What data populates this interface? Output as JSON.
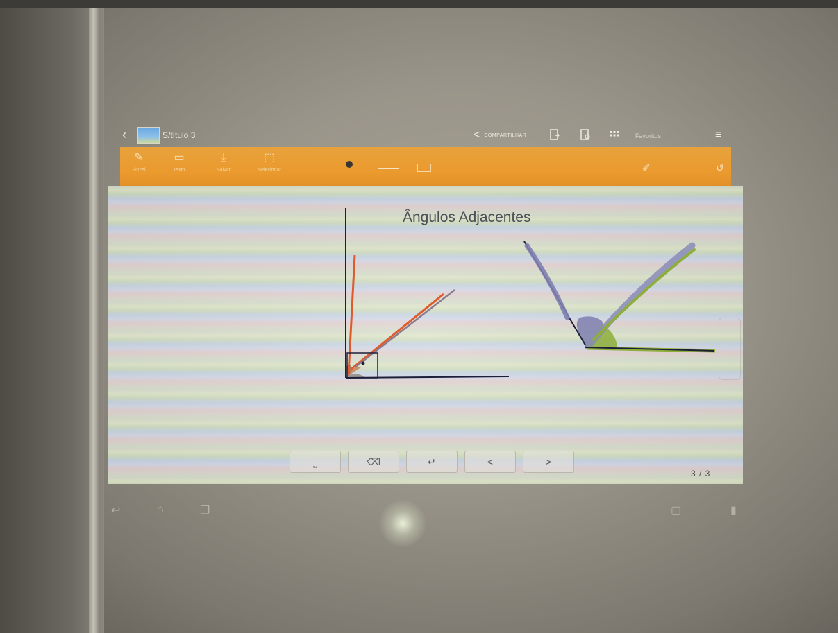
{
  "titlebar": {
    "doc_title": "S/título 3",
    "share_label": "COMPARTILHAR",
    "favorites_label": "Favoritos"
  },
  "toolbar": {
    "tools": [
      {
        "name": "Pincel"
      },
      {
        "name": "Texto"
      },
      {
        "name": "Salvar"
      },
      {
        "name": "Selecionar"
      }
    ]
  },
  "canvas": {
    "title": "Ângulos Adjacentes"
  },
  "keypad": {
    "space": "⎵",
    "backspace": "⌫",
    "enter": "↵",
    "prev": "<",
    "next": ">"
  },
  "page_counter": "3 / 3",
  "colors": {
    "toolbar": "#eb9a2e",
    "ink_black": "#1d1f3a",
    "ink_orange": "#e05a2c",
    "ink_purple": "#7f7fb0",
    "ink_green": "#8dae3a"
  }
}
